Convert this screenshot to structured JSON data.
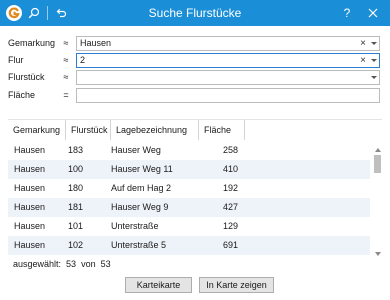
{
  "window": {
    "title": "Suche Flurstücke",
    "help_label": "?",
    "accent": "#1a8fd8"
  },
  "icons": {
    "app": "app-logo-icon",
    "search": "search-icon",
    "undo": "undo-icon",
    "close": "close-icon"
  },
  "form": {
    "fields": [
      {
        "label": "Gemarkung",
        "operator": "≈",
        "value": "Hausen",
        "clear": "×"
      },
      {
        "label": "Flur",
        "operator": "≈",
        "value": "2",
        "clear": "×"
      },
      {
        "label": "Flurstück",
        "operator": "≈",
        "value": "",
        "clear": ""
      },
      {
        "label": "Fläche",
        "operator": "=",
        "value": "",
        "clear": ""
      }
    ]
  },
  "table": {
    "columns": [
      "Gemarkung",
      "Flurstück",
      "Lagebezeichnung",
      "Fläche"
    ],
    "rows": [
      [
        "Hausen",
        "183",
        "Hauser Weg",
        "258"
      ],
      [
        "Hausen",
        "100",
        "Hauser Weg 11",
        "410"
      ],
      [
        "Hausen",
        "180",
        "Auf dem Hag 2",
        "192"
      ],
      [
        "Hausen",
        "181",
        "Hauser Weg 9",
        "427"
      ],
      [
        "Hausen",
        "101",
        "Unterstraße",
        "129"
      ],
      [
        "Hausen",
        "102",
        "Unterstraße 5",
        "691"
      ]
    ]
  },
  "summary": {
    "selected_label": "ausgewählt:",
    "selected_count": "53",
    "of_label": "von",
    "total_count": "53"
  },
  "buttons": {
    "karteikarte": "Karteikarte",
    "show_in_map": "In Karte zeigen"
  }
}
